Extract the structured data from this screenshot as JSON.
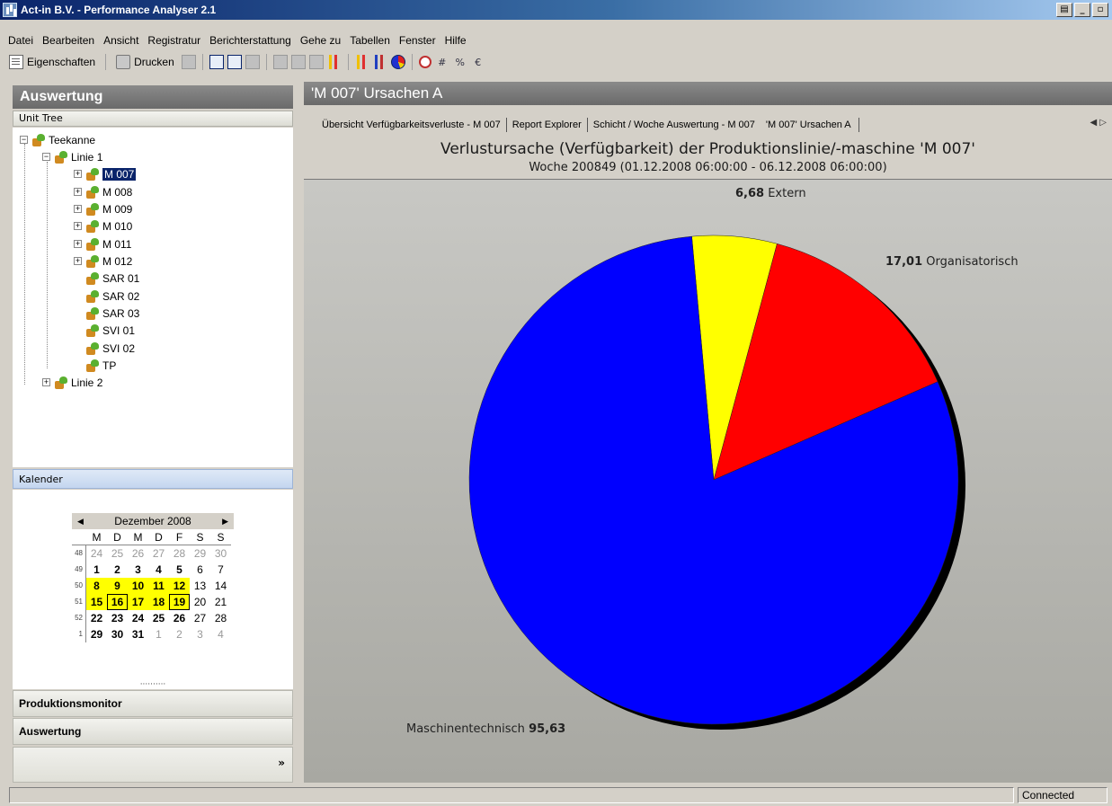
{
  "window": {
    "title": "Act-in B.V. - Performance Analyser 2.1"
  },
  "menu": [
    "Datei",
    "Bearbeiten",
    "Ansicht",
    "Registratur",
    "Berichterstattung",
    "Gehe zu",
    "Tabellen",
    "Fenster",
    "Hilfe"
  ],
  "toolbar": {
    "properties_label": "Eigenschaften",
    "print_label": "Drucken",
    "hash_glyph": "#",
    "percent_glyph": "%",
    "euro_glyph": "€"
  },
  "left_panel": {
    "header": "Auswertung",
    "unit_tree_label": "Unit Tree",
    "tree": {
      "root": "Teekanne",
      "line1": "Linie 1",
      "machines": [
        "M 007",
        "M 008",
        "M 009",
        "M 010",
        "M 011",
        "M 012"
      ],
      "leaves": [
        "SAR 01",
        "SAR 02",
        "SAR 03",
        "SVI 01",
        "SVI 02",
        "TP"
      ],
      "line2": "Linie 2",
      "selected": "M 007"
    },
    "calendar_label": "Kalender",
    "calendar": {
      "month": "Dezember 2008",
      "weekdays": [
        "M",
        "D",
        "M",
        "D",
        "F",
        "S",
        "S"
      ],
      "weeks": [
        {
          "wk": "48",
          "days": [
            "24",
            "25",
            "26",
            "27",
            "28",
            "29",
            "30"
          ]
        },
        {
          "wk": "49",
          "days": [
            "1",
            "2",
            "3",
            "4",
            "5",
            "6",
            "7"
          ]
        },
        {
          "wk": "50",
          "days": [
            "8",
            "9",
            "10",
            "11",
            "12",
            "13",
            "14"
          ]
        },
        {
          "wk": "51",
          "days": [
            "15",
            "16",
            "17",
            "18",
            "19",
            "20",
            "21"
          ]
        },
        {
          "wk": "52",
          "days": [
            "22",
            "23",
            "24",
            "25",
            "26",
            "27",
            "28"
          ]
        },
        {
          "wk": "1",
          "days": [
            "29",
            "30",
            "31",
            "1",
            "2",
            "3",
            "4"
          ]
        }
      ]
    },
    "nav_produktionsmonitor": "Produktionsmonitor",
    "nav_auswertung": "Auswertung",
    "nav_chevron": "»"
  },
  "document": {
    "header": "'M 007' Ursachen A",
    "tabs": [
      "Übersicht Verfügbarkeitsverluste - M 007",
      "Report Explorer",
      "Schicht / Woche Auswertung - M 007",
      "'M 007' Ursachen A"
    ],
    "active_tab": "'M 007' Ursachen A"
  },
  "chart_data": {
    "type": "pie",
    "title": "Verlustursache (Verfügbarkeit) der Produktionslinie/-maschine 'M 007'",
    "subtitle": "Woche 200849 (01.12.2008 06:00:00 - 06.12.2008 06:00:00)",
    "slices": [
      {
        "label": "Extern",
        "value": 6.68,
        "display": "6,68",
        "color": "#ffff00"
      },
      {
        "label": "Organisatorisch",
        "value": 17.01,
        "display": "17,01",
        "color": "#ff0000"
      },
      {
        "label": "Maschinentechnisch",
        "value": 95.63,
        "display": "95,63",
        "color": "#0000ff"
      }
    ]
  },
  "status": {
    "connection": "Connected"
  }
}
